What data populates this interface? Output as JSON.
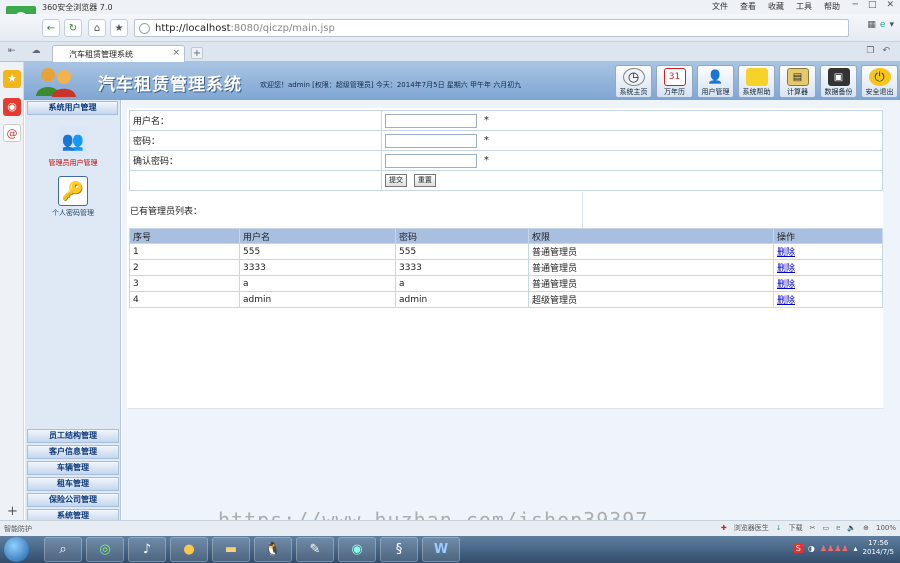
{
  "browser": {
    "app_title": "360安全浏览器 7.0",
    "menu": [
      "文件",
      "查看",
      "收藏",
      "工具",
      "帮助"
    ],
    "address_host": "http://localhost",
    "address_rest": ":8080/qiczp/main.jsp",
    "tab_title": "汽车租赁管理系统"
  },
  "header": {
    "app_name": "汽车租赁管理系统",
    "welcome": "欢迎您！admin [权限：超级管理员] 今天：2014年7月5日 星期六 甲午年 六月初九",
    "buttons": [
      {
        "label": "系统主页",
        "icon": "clock-icon"
      },
      {
        "label": "万年历",
        "icon": "calendar-icon"
      },
      {
        "label": "用户管理",
        "icon": "user-icon"
      },
      {
        "label": "系统帮助",
        "icon": "note-icon"
      },
      {
        "label": "计算器",
        "icon": "calculator-icon"
      },
      {
        "label": "数据备份",
        "icon": "floppy-icon"
      },
      {
        "label": "安全退出",
        "icon": "power-icon"
      }
    ]
  },
  "leftmenu": {
    "section_title": "系统用户管理",
    "item1": "管理员用户管理",
    "item2": "个人密码管理",
    "bottom": [
      "员工结构管理",
      "客户信息管理",
      "车辆管理",
      "租车管理",
      "保险公司管理",
      "系统管理"
    ]
  },
  "form": {
    "username_label": "用户名：",
    "password_label": "密码：",
    "confirm_label": "确认密码：",
    "required_mark": "*",
    "submit_label": "提交",
    "reset_label": "重置"
  },
  "list": {
    "title": "已有管理员列表：",
    "headers": [
      "序号",
      "用户名",
      "密码",
      "权限",
      "操作"
    ],
    "rows": [
      [
        "1",
        "555",
        "555",
        "普通管理员",
        "删除"
      ],
      [
        "2",
        "3333",
        "3333",
        "普通管理员",
        "删除"
      ],
      [
        "3",
        "a",
        "a",
        "普通管理员",
        "删除"
      ],
      [
        "4",
        "admin",
        "admin",
        "超级管理员",
        "删除"
      ]
    ]
  },
  "statusbar": {
    "left": "智能防护",
    "watermark": "https://www.huzhan.com/ishop39397",
    "doctor": "浏览器医生",
    "download": "下载",
    "zoom": "100%"
  },
  "taskbar": {
    "time": "17:56",
    "date": "2014/7/5"
  }
}
